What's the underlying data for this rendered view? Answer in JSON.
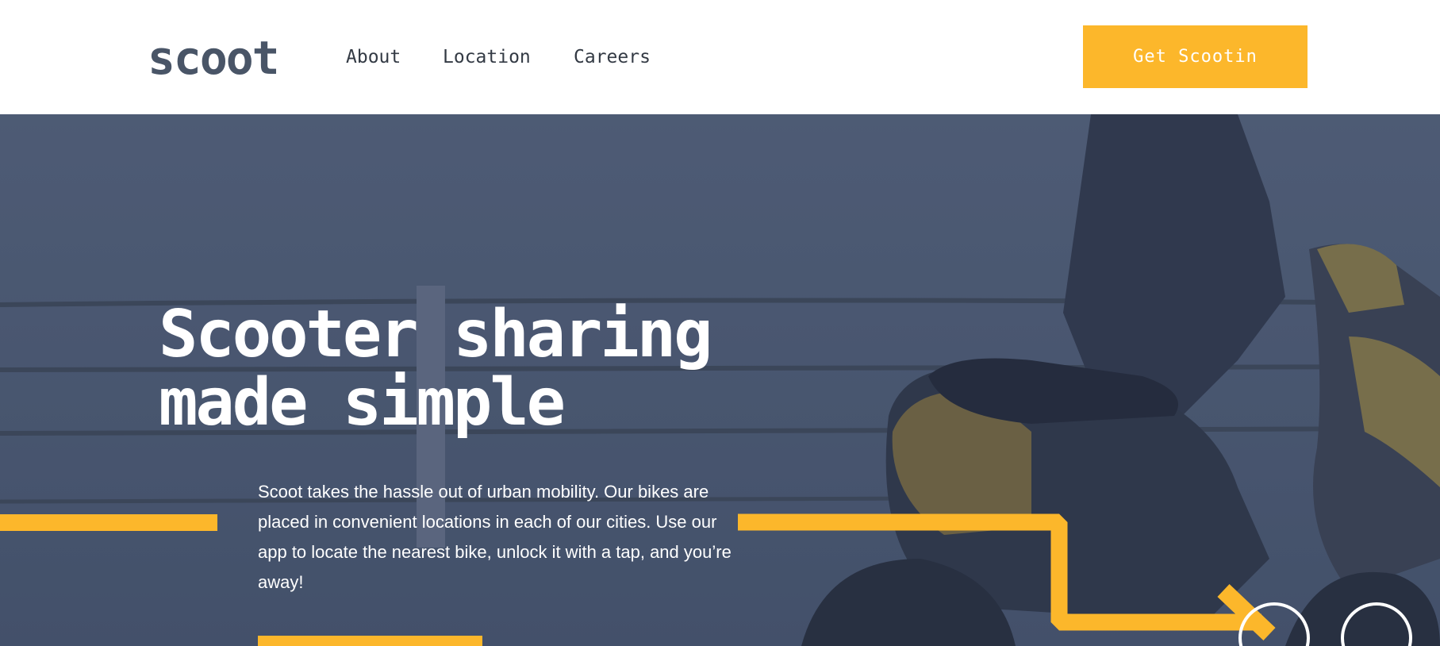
{
  "brand": {
    "logo_text": "scoot"
  },
  "nav": {
    "items": [
      {
        "label": "About"
      },
      {
        "label": "Location"
      },
      {
        "label": "Careers"
      }
    ]
  },
  "header": {
    "cta_label": "Get Scootin"
  },
  "hero": {
    "title_line1": "Scooter sharing",
    "title_line2": "made simple",
    "body": "Scoot takes the hassle out of urban mobility. Our bikes are placed in convenient locations in each of our cities. Use our app to locate the nearest bike, unlock it with a tap, and you’re away!"
  },
  "colors": {
    "accent": "#fcb72b",
    "dark_navy": "#333a44",
    "slate": "#495567",
    "hero_overlay": "#4e5d78"
  },
  "icons": {
    "arrow": "chevron-arrow-icon",
    "circle": "circle-outline-icon"
  }
}
